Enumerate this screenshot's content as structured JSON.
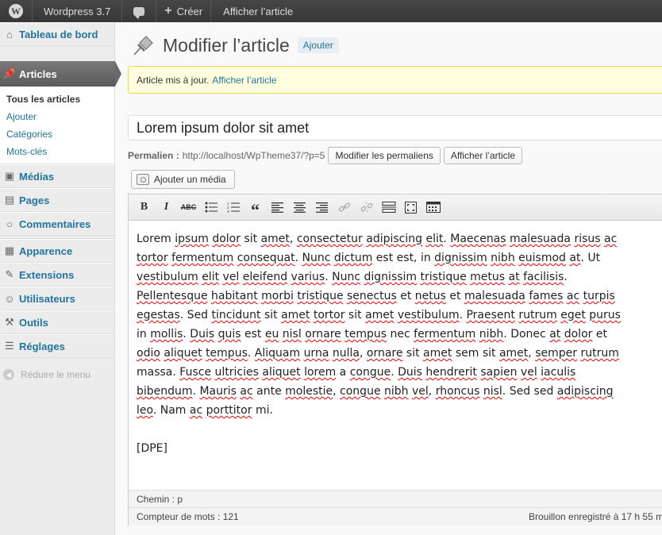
{
  "adminbar": {
    "site_name": "Wordpress 3.7",
    "create_label": "Créer",
    "view_post_label": "Afficher l’article"
  },
  "sidebar": {
    "dashboard": "Tableau de bord",
    "posts": "Articles",
    "submenu": [
      "Tous les articles",
      "Ajouter",
      "Catégories",
      "Mots-clés"
    ],
    "items": [
      "Médias",
      "Pages",
      "Commentaires",
      "Apparence",
      "Extensions",
      "Utilisateurs",
      "Outils",
      "Réglages"
    ],
    "collapse": "Réduire le menu"
  },
  "header": {
    "title": "Modifier l’article",
    "add_new": "Ajouter"
  },
  "notice": {
    "text": "Article mis à jour.",
    "link": "Afficher l’article"
  },
  "post": {
    "title": "Lorem ipsum dolor sit amet",
    "permalink_label": "Permalien :",
    "permalink_url": "http://localhost/WpTheme37/?p=5",
    "edit_permalink_button": "Modifier les permaliens",
    "view_post_button": "Afficher l’article",
    "add_media_button": "Ajouter un média",
    "shortcode": "[DPE]"
  },
  "editor": {
    "toolbar": [
      "bold-icon",
      "italic-icon",
      "strikethrough-icon",
      "bullet-list-icon",
      "numbered-list-icon",
      "blockquote-icon",
      "align-left-icon",
      "align-center-icon",
      "align-right-icon",
      "link-icon",
      "unlink-icon",
      "more-tag-icon",
      "fullscreen-icon",
      "kitchen-sink-icon"
    ],
    "path": "Chemin : p",
    "word_count": "Compteur de mots : 121",
    "draft_saved": "Brouillon enregistré à 17 h 55 m"
  },
  "colors": {
    "adminbar": "#464646",
    "link": "#21759b",
    "notice_bg": "#ffffe0",
    "notice_border": "#e6db55"
  }
}
